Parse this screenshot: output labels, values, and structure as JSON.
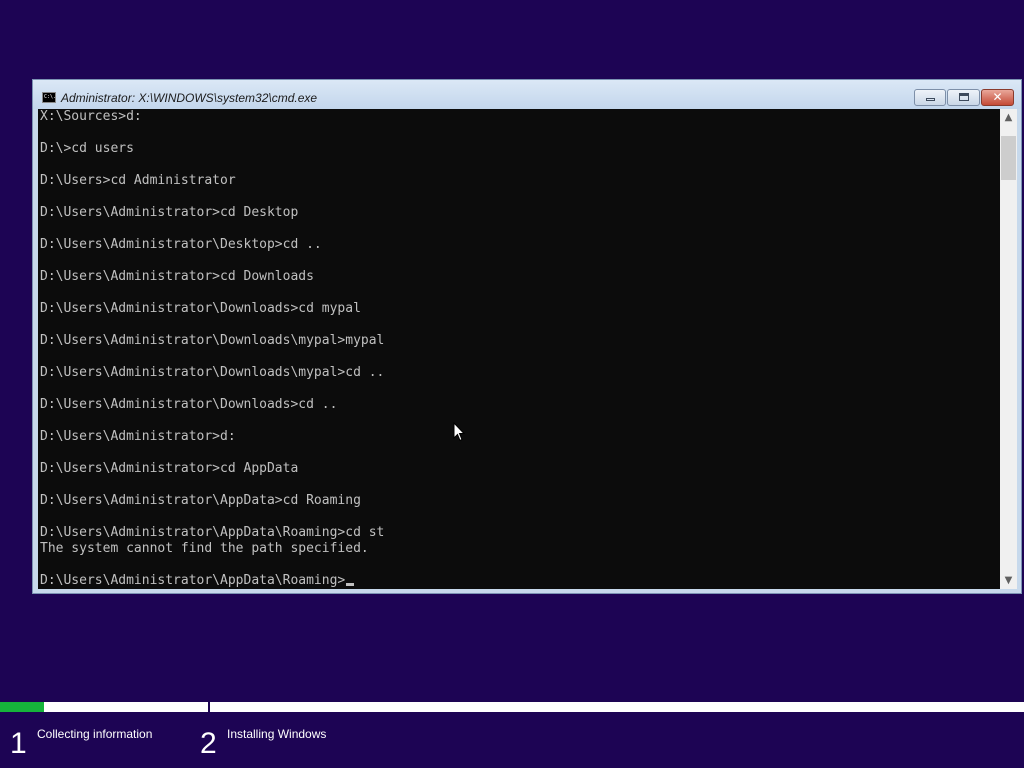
{
  "window": {
    "title": "Administrator: X:\\WINDOWS\\system32\\cmd.exe",
    "icon_label": "C:\\.",
    "buttons": {
      "minimize": "minimize-icon",
      "maximize": "maximize-icon",
      "close": "✕"
    }
  },
  "console": {
    "background": "#0c0c0c",
    "foreground": "#c0c0c0",
    "lines": [
      "X:\\Sources>d:",
      "",
      "D:\\>cd users",
      "",
      "D:\\Users>cd Administrator",
      "",
      "D:\\Users\\Administrator>cd Desktop",
      "",
      "D:\\Users\\Administrator\\Desktop>cd ..",
      "",
      "D:\\Users\\Administrator>cd Downloads",
      "",
      "D:\\Users\\Administrator\\Downloads>cd mypal",
      "",
      "D:\\Users\\Administrator\\Downloads\\mypal>mypal",
      "",
      "D:\\Users\\Administrator\\Downloads\\mypal>cd ..",
      "",
      "D:\\Users\\Administrator\\Downloads>cd ..",
      "",
      "D:\\Users\\Administrator>d:",
      "",
      "D:\\Users\\Administrator>cd AppData",
      "",
      "D:\\Users\\Administrator\\AppData>cd Roaming",
      "",
      "D:\\Users\\Administrator\\AppData\\Roaming>cd st",
      "The system cannot find the path specified.",
      ""
    ],
    "prompt": "D:\\Users\\Administrator\\AppData\\Roaming>"
  },
  "scrollbar": {
    "up_arrow": "▲",
    "down_arrow": "▼"
  },
  "setup": {
    "progress_fraction_step1": 0.21,
    "progress_color": "#16b43b",
    "steps": [
      {
        "number": "1",
        "label": "Collecting information"
      },
      {
        "number": "2",
        "label": "Installing Windows"
      }
    ]
  },
  "colors": {
    "desktop_background": "#1d0454"
  }
}
